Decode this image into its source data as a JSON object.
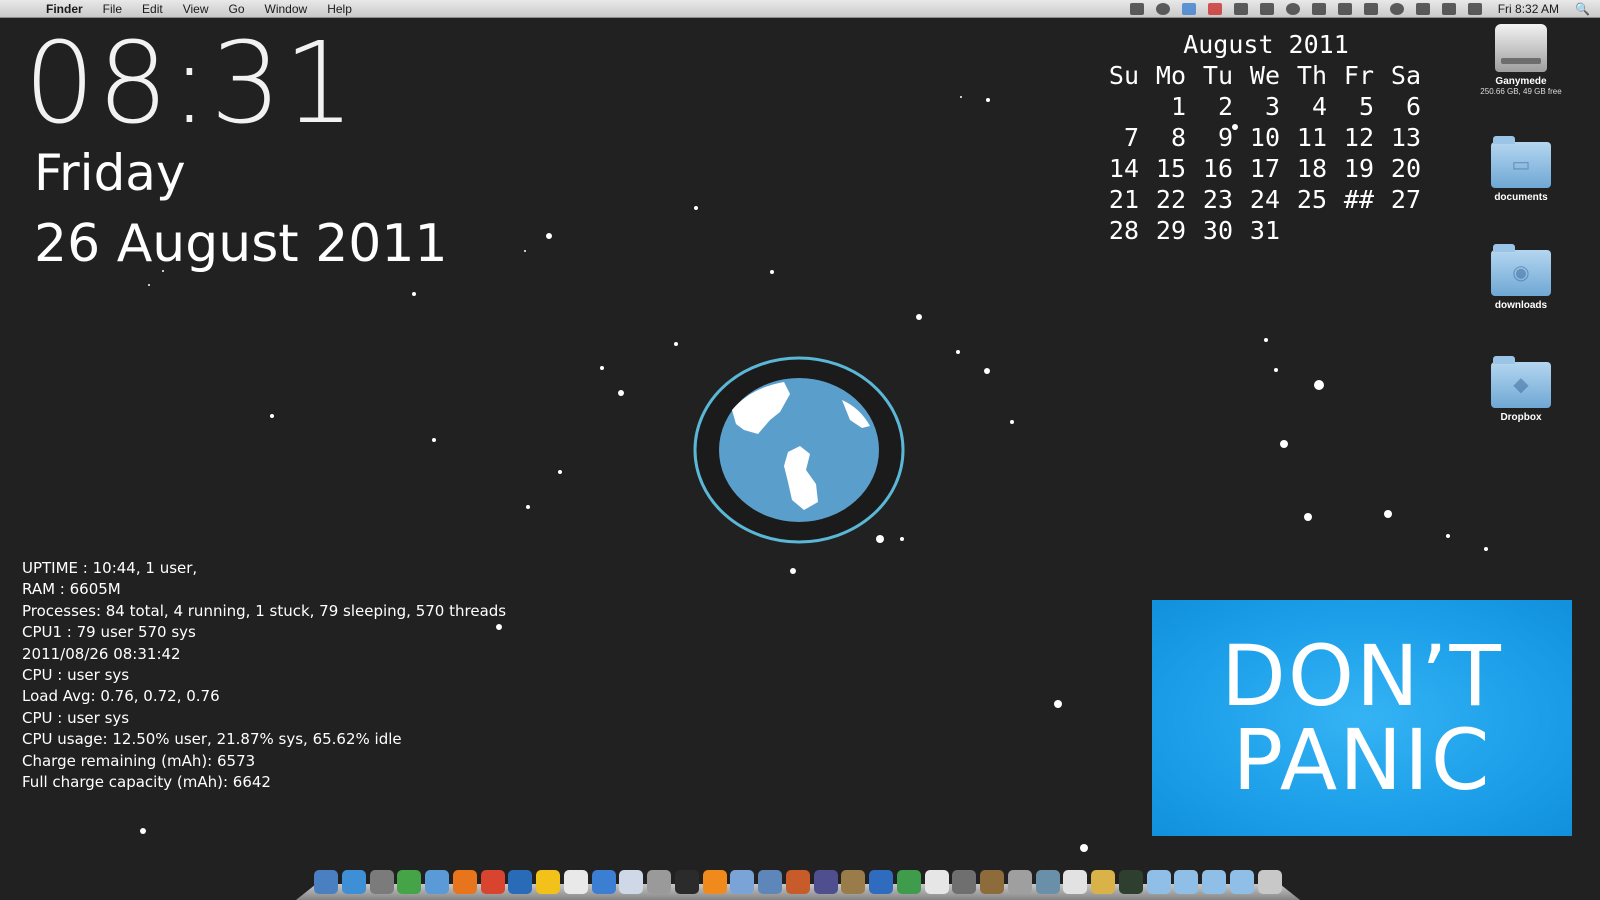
{
  "menubar": {
    "apple": "",
    "app_name": "Finder",
    "items": [
      "File",
      "Edit",
      "View",
      "Go",
      "Window",
      "Help"
    ],
    "clock": "Fri 8:32 AM",
    "status_icons": [
      "keyboard-icon",
      "wheel-icon",
      "skype-icon",
      "camera-red-icon",
      "camera-icon",
      "chevron-icon",
      "sync-icon",
      "eye-icon",
      "dual-icon",
      "display-icon",
      "timemachine-icon",
      "wifi-icon",
      "volume-icon",
      "battery-icon"
    ],
    "spotlight": "🔍"
  },
  "clock": {
    "time": "08:31",
    "day": "Friday",
    "date": "26 August 2011"
  },
  "calendar": {
    "title": "August 2011",
    "weekdays": [
      "Su",
      "Mo",
      "Tu",
      "We",
      "Th",
      "Fr",
      "Sa"
    ],
    "rows": [
      [
        "",
        "1",
        "2",
        "3",
        "4",
        "5",
        "6"
      ],
      [
        "7",
        "8",
        "9",
        "10",
        "11",
        "12",
        "13"
      ],
      [
        "14",
        "15",
        "16",
        "17",
        "18",
        "19",
        "20"
      ],
      [
        "21",
        "22",
        "23",
        "24",
        "25",
        "##",
        "27"
      ],
      [
        "28",
        "29",
        "30",
        "31",
        "",
        "",
        ""
      ]
    ]
  },
  "desktop_icons": {
    "drive": {
      "label": "Ganymede",
      "sublabel": "250.66 GB, 49 GB free",
      "icon": "hard-drive-icon"
    },
    "documents": {
      "label": "documents",
      "icon": "folder-icon"
    },
    "downloads": {
      "label": "downloads",
      "icon": "folder-icon"
    },
    "dropbox": {
      "label": "Dropbox",
      "icon": "folder-icon"
    }
  },
  "sysinfo": {
    "lines": [
      "UPTIME : 10:44, 1 user,",
      "RAM : 6605M",
      "Processes: 84 total, 4 running, 1 stuck, 79 sleeping, 570 threads",
      "CPU1 : 79 user  570 sys",
      "2011/08/26 08:31:42",
      "CPU :  user   sys",
      "Load Avg: 0.76, 0.72, 0.76",
      "CPU :  user   sys",
      "CPU usage: 12.50% user, 21.87% sys, 65.62% idle",
      "Charge remaining (mAh): 6573",
      "Full charge capacity (mAh): 6642"
    ]
  },
  "banner": {
    "line1": "DON’T",
    "line2": "PANIC",
    "color": "#1ea1ea"
  },
  "dock": {
    "icons": [
      {
        "name": "finder-icon",
        "color": "#4a7fc1"
      },
      {
        "name": "safari-icon",
        "color": "#3f8fd6"
      },
      {
        "name": "system-prefs-icon",
        "color": "#7b7b7b"
      },
      {
        "name": "app-store-icon",
        "color": "#45a348"
      },
      {
        "name": "mail-icon",
        "color": "#5a9ad6"
      },
      {
        "name": "firefox-icon",
        "color": "#e8741c"
      },
      {
        "name": "chrome-icon",
        "color": "#d9442f"
      },
      {
        "name": "thunderbird-icon",
        "color": "#2a6bb8"
      },
      {
        "name": "stickies-icon",
        "color": "#f2c21b"
      },
      {
        "name": "ical-icon",
        "color": "#e9e9e9"
      },
      {
        "name": "itunes-icon",
        "color": "#3b7ed2"
      },
      {
        "name": "pages-icon",
        "color": "#cfd8e6"
      },
      {
        "name": "aperture-icon",
        "color": "#9a9a9a"
      },
      {
        "name": "terminal-icon",
        "color": "#2b2b2b"
      },
      {
        "name": "vlc-icon",
        "color": "#f08a1c"
      },
      {
        "name": "transmit-icon",
        "color": "#7aa4d8"
      },
      {
        "name": "xcode-icon",
        "color": "#5e86b8"
      },
      {
        "name": "keynote-icon",
        "color": "#c85b2a"
      },
      {
        "name": "dashcode-icon",
        "color": "#4f4f8f"
      },
      {
        "name": "automator-icon",
        "color": "#9a7c4a"
      },
      {
        "name": "word-icon",
        "color": "#2f6cc0"
      },
      {
        "name": "numbers-icon",
        "color": "#3e9c4c"
      },
      {
        "name": "flashcard-icon",
        "color": "#e6e6e6"
      },
      {
        "name": "scanner-icon",
        "color": "#6f6f6f"
      },
      {
        "name": "growl-icon",
        "color": "#8d6b3a"
      },
      {
        "name": "utility-icon",
        "color": "#9f9f9f"
      },
      {
        "name": "disk-util-icon",
        "color": "#6a8fa8"
      },
      {
        "name": "doc-icon",
        "color": "#e2e2e2"
      },
      {
        "name": "notes-icon",
        "color": "#d9b347"
      },
      {
        "name": "activity-icon",
        "color": "#2f3f2f"
      },
      {
        "name": "folder-apps-icon",
        "color": "#8fbfe6"
      },
      {
        "name": "folder-docs-icon",
        "color": "#8fbfe6"
      },
      {
        "name": "folder-dl-icon",
        "color": "#8fbfe6"
      },
      {
        "name": "folder-misc-icon",
        "color": "#8fbfe6"
      },
      {
        "name": "trash-icon",
        "color": "#c8c8c8"
      }
    ]
  }
}
